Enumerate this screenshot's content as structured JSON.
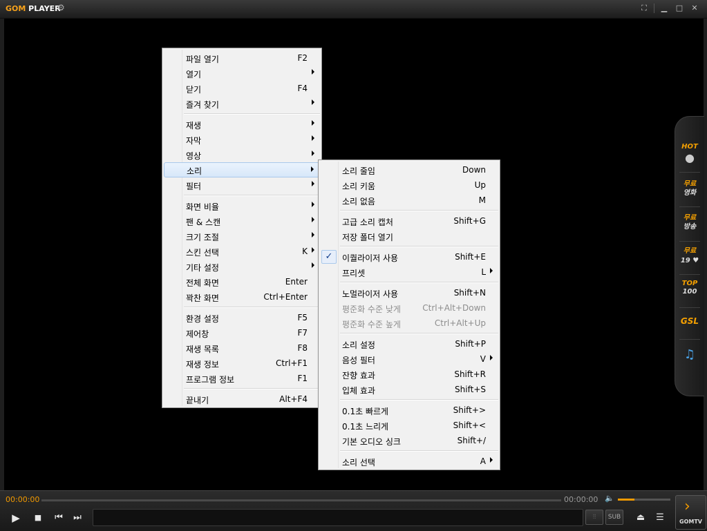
{
  "app": {
    "logo_a": "GOM",
    "logo_b": "PLAYER"
  },
  "main_menu": [
    {
      "label": "파일 열기",
      "shortcut": "F2",
      "submenu": false
    },
    {
      "label": "열기",
      "shortcut": "",
      "submenu": true
    },
    {
      "label": "닫기",
      "shortcut": "F4",
      "submenu": false
    },
    {
      "label": "즐겨 찾기",
      "shortcut": "",
      "submenu": true
    },
    {
      "label": "재생",
      "shortcut": "",
      "submenu": true
    },
    {
      "label": "자막",
      "shortcut": "",
      "submenu": true
    },
    {
      "label": "영상",
      "shortcut": "",
      "submenu": true
    },
    {
      "label": "소리",
      "shortcut": "",
      "submenu": true,
      "highlighted": true
    },
    {
      "label": "필터",
      "shortcut": "",
      "submenu": true
    },
    {
      "label": "화면 비율",
      "shortcut": "",
      "submenu": true
    },
    {
      "label": "팬 & 스캔",
      "shortcut": "",
      "submenu": true
    },
    {
      "label": "크기 조절",
      "shortcut": "",
      "submenu": true
    },
    {
      "label": "스킨 선택",
      "shortcut": "K",
      "submenu": true
    },
    {
      "label": "기타 설정",
      "shortcut": "",
      "submenu": true
    },
    {
      "label": "전체 화면",
      "shortcut": "Enter",
      "submenu": false
    },
    {
      "label": "꽉찬 화면",
      "shortcut": "Ctrl+Enter",
      "submenu": false
    },
    {
      "label": "환경 설정",
      "shortcut": "F5",
      "submenu": false
    },
    {
      "label": "제어창",
      "shortcut": "F7",
      "submenu": false
    },
    {
      "label": "재생 목록",
      "shortcut": "F8",
      "submenu": false
    },
    {
      "label": "재생 정보",
      "shortcut": "Ctrl+F1",
      "submenu": false
    },
    {
      "label": "프로그램 정보",
      "shortcut": "F1",
      "submenu": false
    },
    {
      "label": "끝내기",
      "shortcut": "Alt+F4",
      "submenu": false
    }
  ],
  "sound_menu": [
    {
      "label": "소리 줄임",
      "shortcut": "Down"
    },
    {
      "label": "소리 키움",
      "shortcut": "Up"
    },
    {
      "label": "소리 없음",
      "shortcut": "M"
    },
    {
      "label": "고급 소리 캡처",
      "shortcut": "Shift+G"
    },
    {
      "label": "저장 폴더 열기",
      "shortcut": ""
    },
    {
      "label": "이퀄라이저 사용",
      "shortcut": "Shift+E",
      "checked": true
    },
    {
      "label": "프리셋",
      "shortcut": "L",
      "submenu": true
    },
    {
      "label": "노멀라이저 사용",
      "shortcut": "Shift+N"
    },
    {
      "label": "평준화 수준 낮게",
      "shortcut": "Ctrl+Alt+Down",
      "disabled": true
    },
    {
      "label": "평준화 수준 높게",
      "shortcut": "Ctrl+Alt+Up",
      "disabled": true
    },
    {
      "label": "소리 설정",
      "shortcut": "Shift+P"
    },
    {
      "label": "음성 필터",
      "shortcut": "V",
      "submenu": true
    },
    {
      "label": "잔향 효과",
      "shortcut": "Shift+R"
    },
    {
      "label": "입체 효과",
      "shortcut": "Shift+S"
    },
    {
      "label": "0.1초 빠르게",
      "shortcut": "Shift+>"
    },
    {
      "label": "0.1초 느리게",
      "shortcut": "Shift+<"
    },
    {
      "label": "기본 오디오 싱크",
      "shortcut": "Shift+/"
    },
    {
      "label": "소리 선택",
      "shortcut": "A",
      "submenu": true
    }
  ],
  "side_panel": {
    "hot": "HOT",
    "free_movie_a": "무료",
    "free_movie_b": "영화",
    "free_bc_a": "무료",
    "free_bc_b": "방송",
    "free19_a": "무료",
    "free19_b": "19",
    "top_a": "TOP",
    "top_b": "100",
    "gsl": "GSL"
  },
  "player": {
    "time_current": "00:00:00",
    "time_total": "00:00:00",
    "volume_level": 0.32,
    "sub_label": "SUB",
    "gomtv_label": "GOMTV"
  }
}
